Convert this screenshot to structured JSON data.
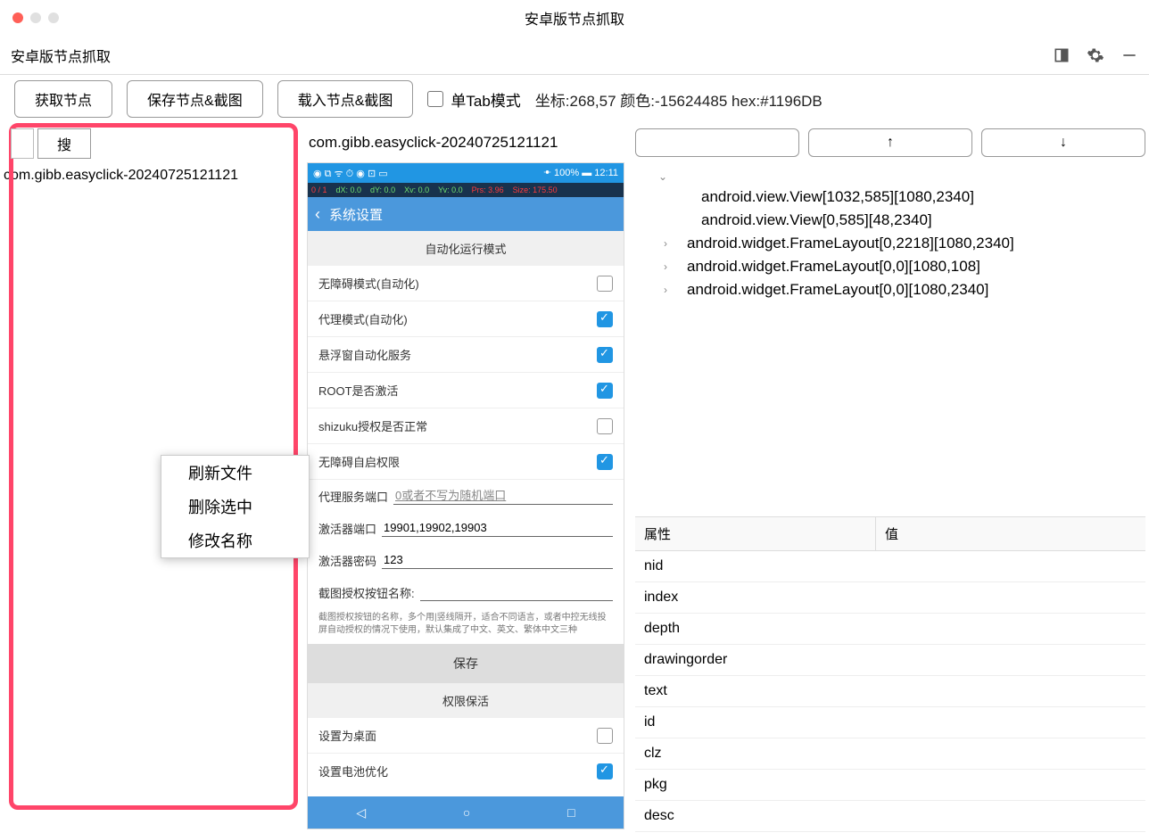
{
  "window": {
    "title": "安卓版节点抓取"
  },
  "subbar": {
    "title": "安卓版节点抓取"
  },
  "toolbar": {
    "get_node": "获取节点",
    "save_node": "保存节点&截图",
    "load_node": "载入节点&截图",
    "single_tab": "单Tab模式",
    "status": "坐标:268,57 颜色:-15624485 hex:#1196DB"
  },
  "left": {
    "search_btn": "搜",
    "file": "com.gibb.easyclick-20240725121121"
  },
  "context_menu": {
    "refresh": "刷新文件",
    "delete": "删除选中",
    "rename": "修改名称"
  },
  "mid": {
    "title": "com.gibb.easyclick-20240725121121",
    "status_left": "◉ ⧉ ᯤ ⏱ ◉ ⊡ ▭",
    "status_right": "ꔹ 100% ▬ 12:11",
    "debug": {
      "a": "0 / 1",
      "b": "dX: 0.0",
      "c": "dY: 0.0",
      "d": "Xv: 0.0",
      "e": "Yv: 0.0",
      "f": "Prs: 3.96",
      "g": "Size: 175.50"
    },
    "nav_title": "系统设置",
    "sect1": "自动化运行模式",
    "rows": {
      "r1": "无障碍模式(自动化)",
      "r2": "代理模式(自动化)",
      "r3": "悬浮窗自动化服务",
      "r4": "ROOT是否激活",
      "r5": "shizuku授权是否正常",
      "r6": "无障碍自启权限"
    },
    "proxy_port_label": "代理服务端口",
    "proxy_port_ph": "0或者不写为随机端口",
    "act_port_label": "激活器端口",
    "act_port_val": "19901,19902,19903",
    "act_pwd_label": "激活器密码",
    "act_pwd_val": "123",
    "shot_label": "截图授权按钮名称:",
    "hint": "截图授权按钮的名称，多个用|竖线隔开，适合不同语言，或者中控无线投屏自动授权的情况下使用，默认集成了中文、英文、繁体中文三种",
    "save": "保存",
    "sect2": "权限保活",
    "r7": "设置为桌面",
    "r8": "设置电池优化"
  },
  "right": {
    "arrow_up": "↑",
    "arrow_down": "↓",
    "tree": [
      {
        "exp": "",
        "label": "android.view.View[1032,585][1080,2340]"
      },
      {
        "exp": "",
        "label": "android.view.View[0,585][48,2340]"
      },
      {
        "exp": "›",
        "label": "android.widget.FrameLayout[0,2218][1080,2340]"
      },
      {
        "exp": "›",
        "label": "android.widget.FrameLayout[0,0][1080,108]"
      },
      {
        "exp": "›",
        "label": "android.widget.FrameLayout[0,0][1080,2340]"
      }
    ],
    "props_header": {
      "attr": "属性",
      "val": "值"
    },
    "props": [
      "nid",
      "index",
      "depth",
      "drawingorder",
      "text",
      "id",
      "clz",
      "pkg",
      "desc"
    ]
  }
}
